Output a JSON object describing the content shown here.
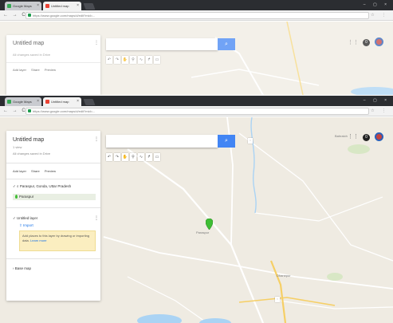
{
  "top": {
    "tabs": [
      {
        "label": "Google Maps",
        "color": "#34a853"
      },
      {
        "label": "Untitled map",
        "color": "#ea4335"
      }
    ],
    "url": "https://www.google.com/maps/d/edit?mid=...",
    "panel": {
      "title": "Untitled map",
      "status": "All changes saved in Drive",
      "actions": [
        "Add layer",
        "Share",
        "Preview"
      ]
    }
  },
  "bottom": {
    "tabs": [
      {
        "label": "Google Maps",
        "color": "#34a853"
      },
      {
        "label": "Untitled map",
        "color": "#ea4335"
      }
    ],
    "url": "https://www.google.com/maps/d/edit?mid=...",
    "panel": {
      "title": "Untitled map",
      "views": "1 view",
      "status": "All changes saved in Drive",
      "actions": [
        "Add layer",
        "Share",
        "Preview"
      ],
      "layer1_title": "Paraspur, Gonda, Uttar Pradesh",
      "layer1_item": "Paraspur",
      "layer2_title": "Untitled layer",
      "layer2_import": "Import",
      "note": "Add places to this layer by drawing or importing data.",
      "note_link": "Learn more",
      "basemap": "Base map"
    },
    "search_icon": "search-icon",
    "notifications": "0",
    "places": {
      "paraspur": "Paraspur",
      "bahraich": "Bahraich",
      "dhanepur": "Dhanepur"
    }
  },
  "colors": {
    "accent": "#4285f4",
    "pin": "#3fbe34",
    "map_bg": "#efebe2",
    "note_bg": "#fbeec0"
  }
}
